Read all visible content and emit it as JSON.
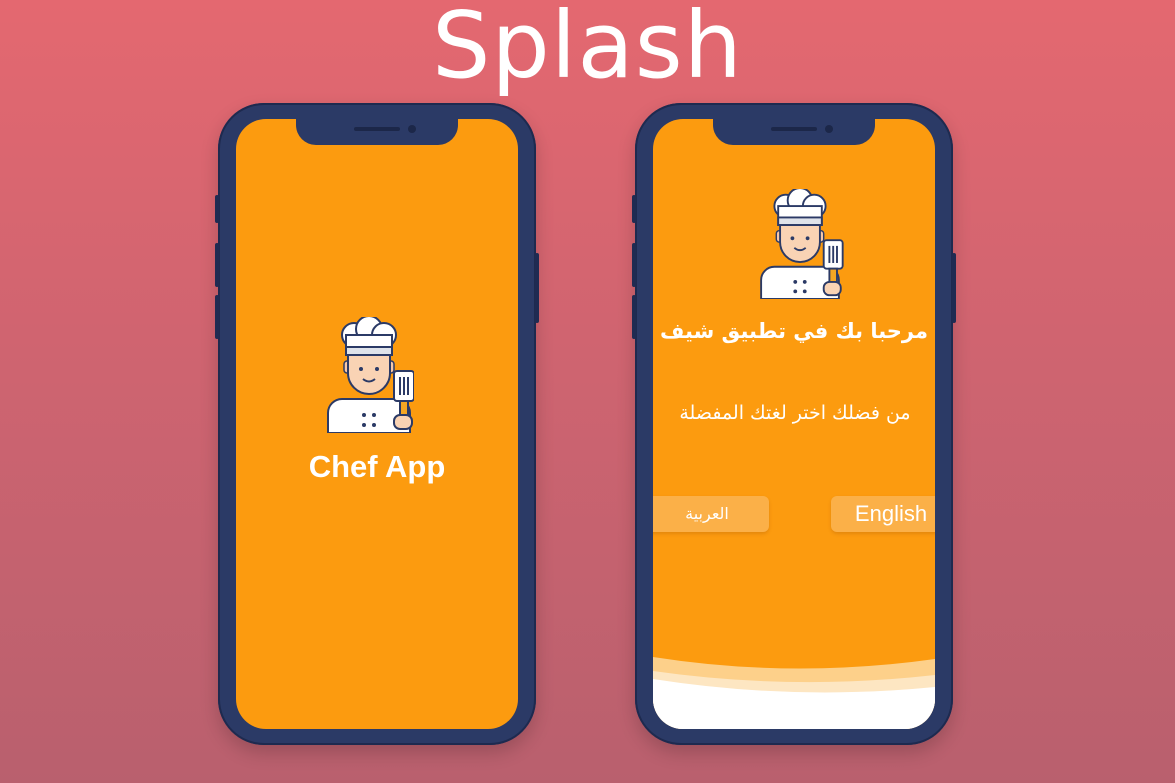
{
  "page": {
    "title": "Splash"
  },
  "phone_left": {
    "app_name": "Chef App",
    "logo_icon": "chef-icon",
    "screen_color": "#fc9b0f"
  },
  "phone_right": {
    "logo_icon": "chef-icon",
    "welcome_text": "مرحبا بك في تطبيق شيف",
    "choose_language_text": "من فضلك اختر لغتك المفضلة",
    "buttons": {
      "english_label": "English",
      "arabic_label": "العربية"
    }
  },
  "colors": {
    "background_top": "#e46870",
    "background_bottom": "#b9606e",
    "phone_frame": "#2b3a66",
    "accent": "#fc9b0f",
    "button_bg": "#fbb048"
  }
}
